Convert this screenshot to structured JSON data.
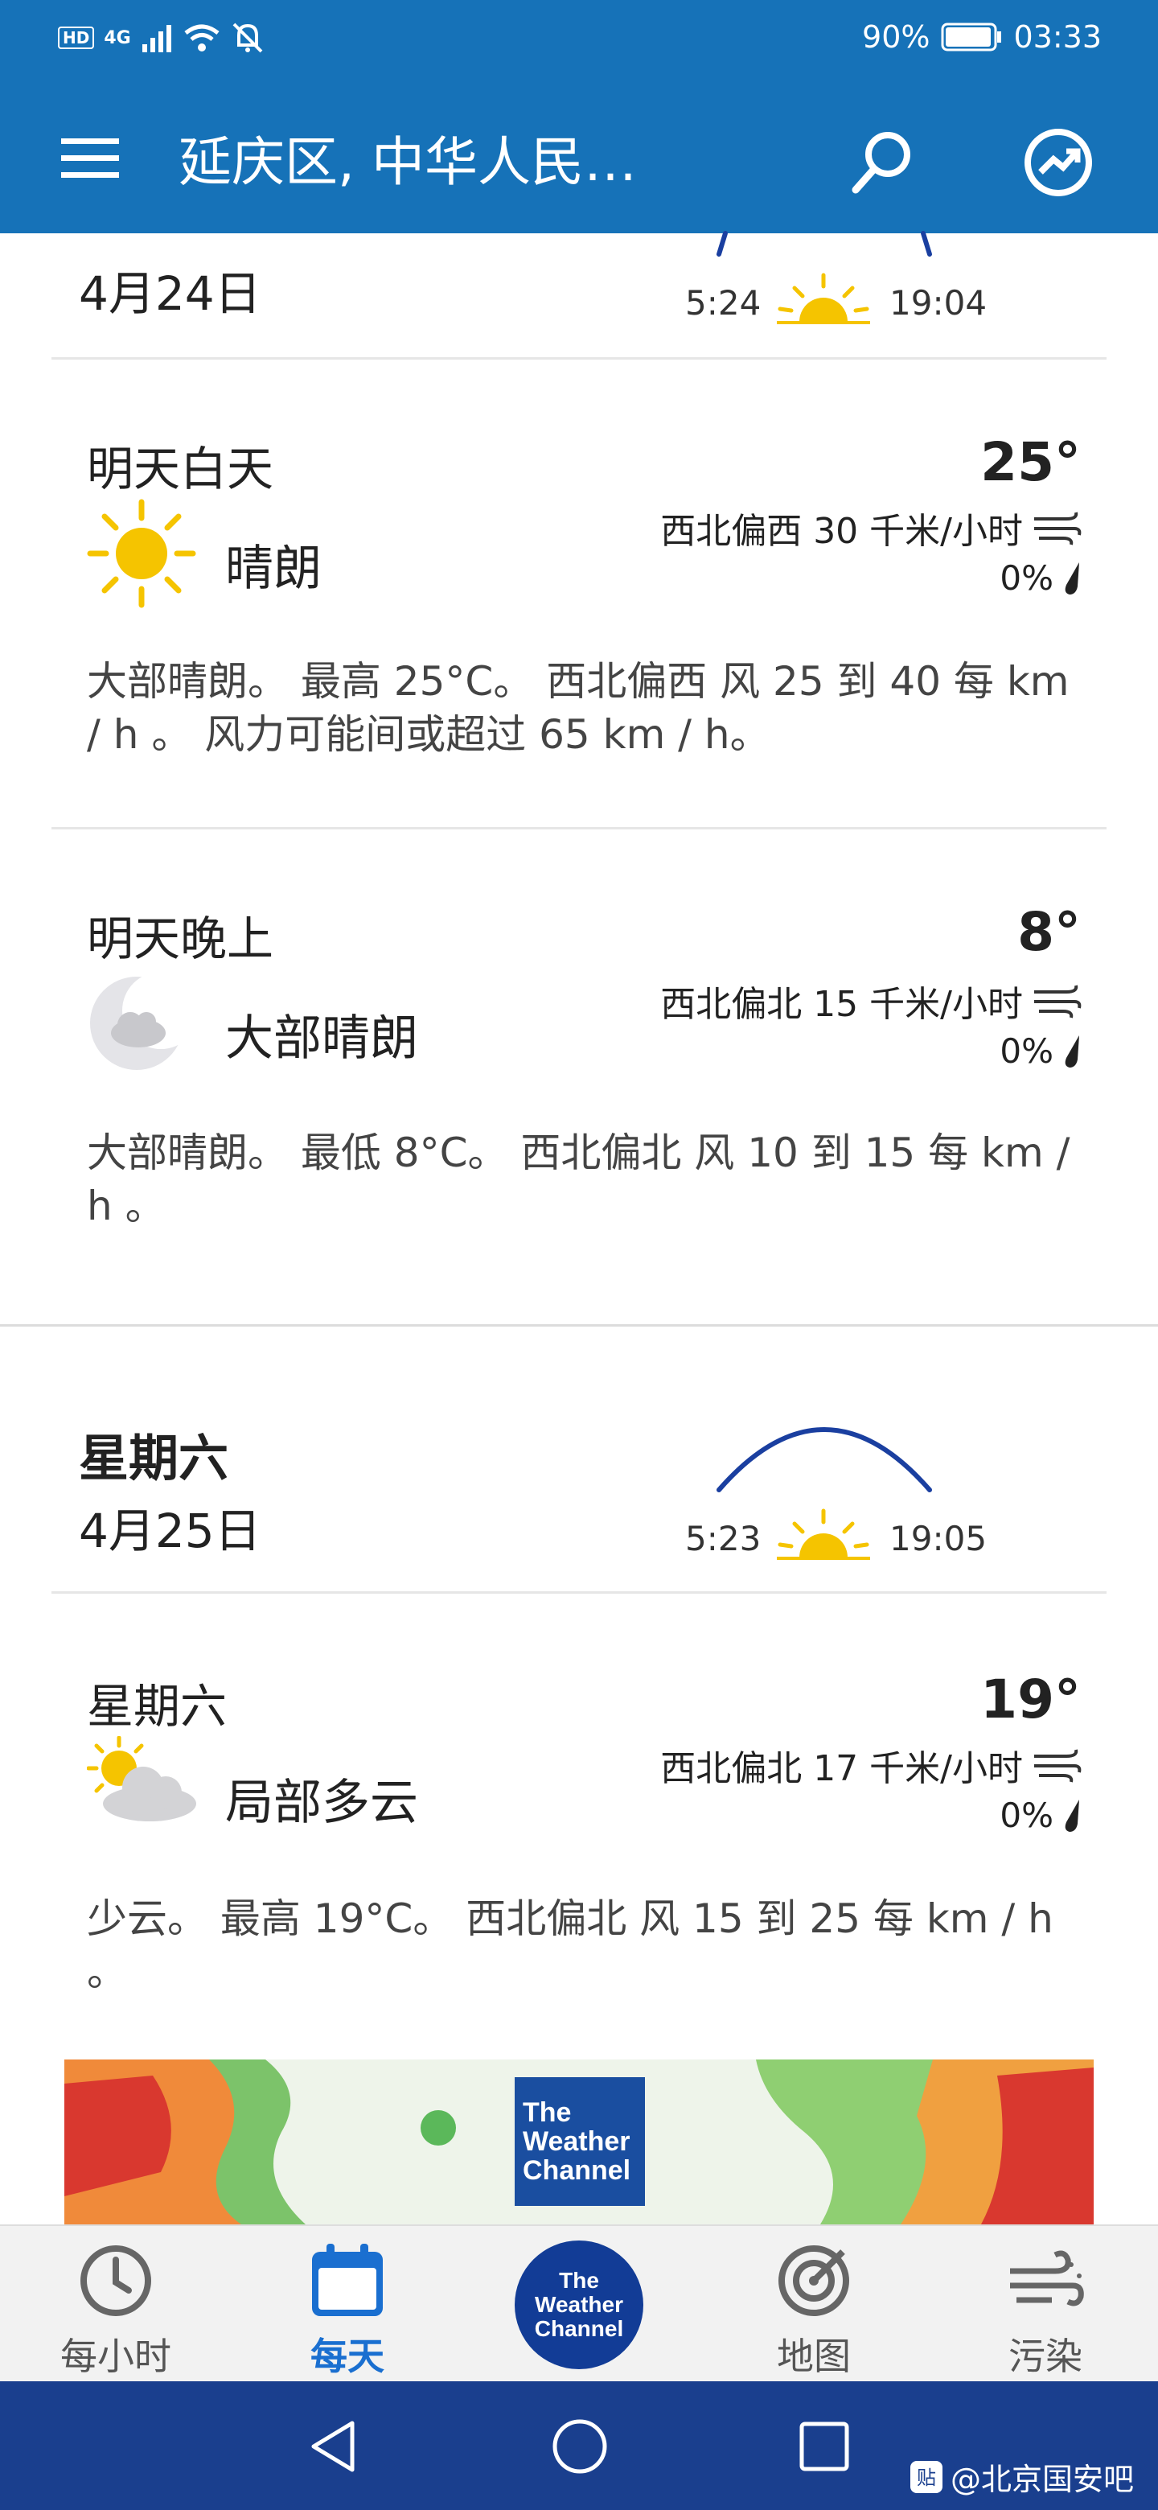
{
  "status_bar": {
    "hd": "HD",
    "signal": "4G",
    "battery": "90%",
    "time": "03:33"
  },
  "appbar": {
    "title": "延庆区, 中华人民…"
  },
  "days": [
    {
      "name": "",
      "date": "4月24日",
      "sunrise": "5:24",
      "sunset": "19:04",
      "periods": [
        {
          "title": "明天白天",
          "temp": "25°",
          "icon": "sunny-icon",
          "condition": "晴朗",
          "wind": "西北偏西 30 千米/小时",
          "precip": "0%",
          "desc": "大部晴朗。 最高 25°C。 西北偏西 风 25 到 40 每 km / h 。 风力可能间或超过 65 km / h。"
        },
        {
          "title": "明天晚上",
          "temp": "8°",
          "icon": "moon-cloud-icon",
          "condition": "大部晴朗",
          "wind": "西北偏北 15 千米/小时",
          "precip": "0%",
          "desc": "大部晴朗。 最低 8°C。 西北偏北 风 10 到 15 每 km / h 。"
        }
      ]
    },
    {
      "name": "星期六",
      "date": "4月25日",
      "sunrise": "5:23",
      "sunset": "19:05",
      "periods": [
        {
          "title": "星期六",
          "temp": "19°",
          "icon": "partly-cloudy-icon",
          "condition": "局部多云",
          "wind": "西北偏北 17 千米/小时",
          "precip": "0%",
          "desc": "少云。 最高 19°C。 西北偏北 风 15 到 25 每 km / h 。"
        }
      ]
    }
  ],
  "ad": {
    "logo_line1": "The",
    "logo_line2": "Weather",
    "logo_line3": "Channel"
  },
  "bottom_nav": {
    "hourly": "每小时",
    "daily": "每天",
    "twc_line1": "The",
    "twc_line2": "Weather",
    "twc_line3": "Channel",
    "map": "地图",
    "pollution": "污染"
  },
  "watermark": "@北京国安吧",
  "colors": {
    "primary": "#1672b8",
    "nav_active": "#1a6fd0",
    "twc_blue": "#123c96",
    "sys_nav": "#1a3f8e",
    "sun": "#f5c400"
  }
}
